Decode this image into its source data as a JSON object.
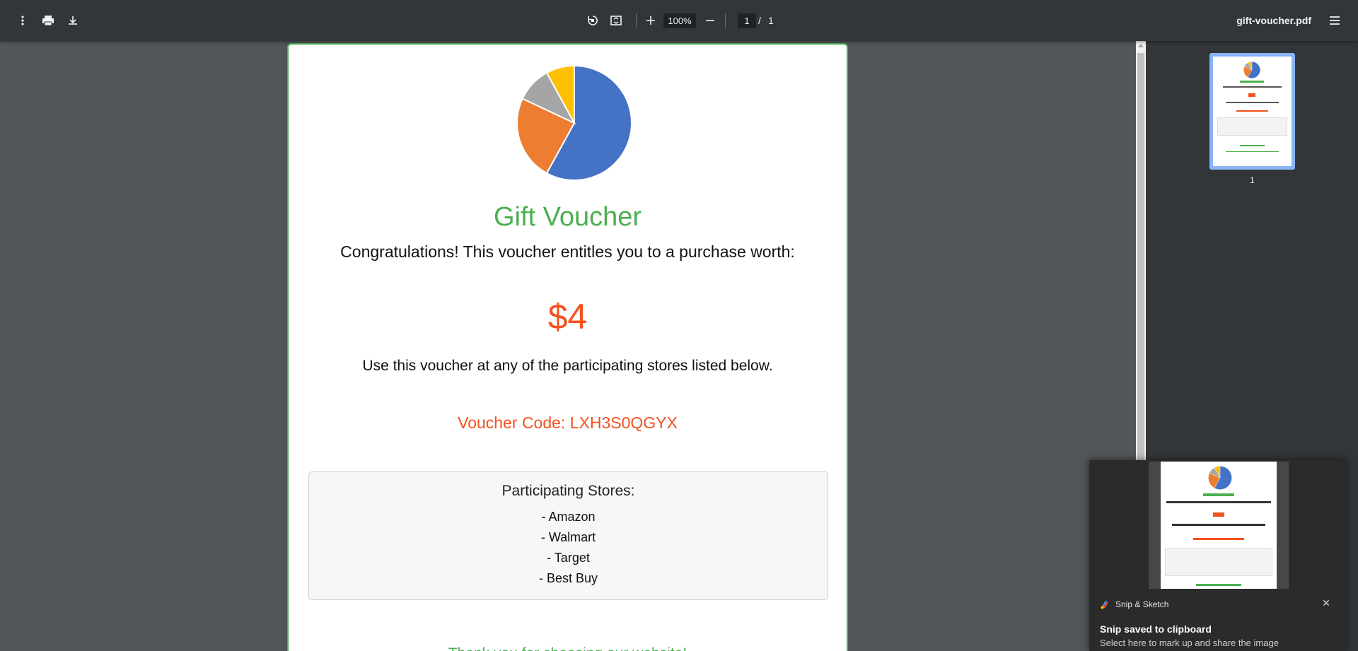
{
  "toolbar": {
    "icons": [
      "more-vertical-icon",
      "print-icon",
      "download-icon",
      "rotate-icon",
      "fit-page-icon",
      "zoom-in-icon",
      "zoom-out-icon",
      "menu-icon"
    ],
    "zoom": "100%",
    "page_current": "1",
    "page_separator": "/",
    "page_total": "1",
    "file_name": "gift-voucher.pdf"
  },
  "voucher": {
    "title": "Gift Voucher",
    "congrats": "Congratulations! This voucher entitles you to a purchase worth:",
    "amount": "$4",
    "use_text": "Use this voucher at any of the participating stores listed below.",
    "code_text": "Voucher Code: LXH3S0QGYX",
    "stores_title": "Participating Stores:",
    "stores": [
      "- Amazon",
      "- Walmart",
      "- Target",
      "- Best Buy"
    ],
    "footer_text": "Thank you for choosing our website!"
  },
  "colors": {
    "accent_green": "#4caf50",
    "accent_orange": "#f4511e",
    "toolbar_bg": "#323639",
    "viewer_bg": "#525659"
  },
  "chart_data": {
    "type": "pie",
    "values": [
      58,
      24,
      10,
      8
    ],
    "colors": [
      "#4472c4",
      "#ed7d31",
      "#a5a5a5",
      "#ffc000"
    ]
  },
  "sidebar": {
    "thumbnail_label": "1"
  },
  "toast": {
    "app_name": "Snip & Sketch",
    "title": "Snip saved to clipboard",
    "body": "Select here to mark up and share the image"
  }
}
